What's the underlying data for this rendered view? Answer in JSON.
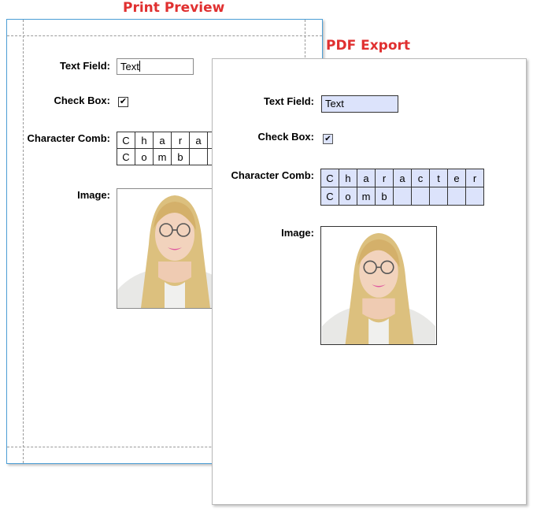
{
  "captions": {
    "print_preview": "Print Preview",
    "pdf_export": "PDF Export"
  },
  "print_preview": {
    "labels": {
      "text_field": "Text Field:",
      "check_box": "Check Box:",
      "character_comb": "Character Comb:",
      "image": "Image:"
    },
    "text_field_value": "Text",
    "check_box_checked": true,
    "comb_rows": [
      [
        "C",
        "h",
        "a",
        "r",
        "a"
      ],
      [
        "C",
        "o",
        "m",
        "b",
        ""
      ]
    ]
  },
  "pdf_export": {
    "labels": {
      "text_field": "Text Field:",
      "check_box": "Check Box:",
      "character_comb": "Character Comb:",
      "image": "Image:"
    },
    "text_field_value": "Text",
    "check_box_checked": true,
    "comb_rows": [
      [
        "C",
        "h",
        "a",
        "r",
        "a",
        "c",
        "t",
        "e",
        "r"
      ],
      [
        "C",
        "o",
        "m",
        "b",
        "",
        "",
        "",
        "",
        ""
      ]
    ],
    "field_fill_color": "#dce3fb"
  },
  "colors": {
    "caption": "#e03030",
    "print_page_border": "#4d9fd6",
    "guide_lines": "#9a9a9a"
  },
  "icons": {
    "check_mark": "check-icon",
    "photo": "portrait-photo"
  }
}
